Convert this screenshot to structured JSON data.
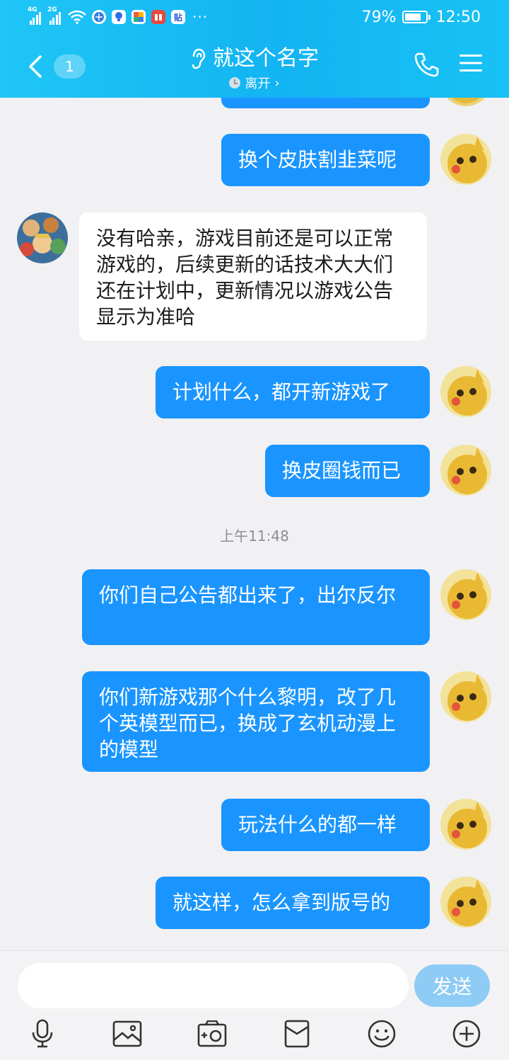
{
  "status_bar": {
    "signal_1_label": "4G",
    "signal_2_label": "2G",
    "battery_percent_text": "79%",
    "battery_level": 0.79,
    "time": "12:50",
    "app_icons": [
      "wifi-icon",
      "browser-icon",
      "lightbulb-icon",
      "colorful-app-icon",
      "book-icon",
      "tieba-icon"
    ]
  },
  "header": {
    "back_badge_count": "1",
    "title": "就这个名字",
    "title_icon": "ear-icon",
    "subtitle": "离开",
    "subtitle_arrow": "›",
    "phone_icon": "phone-icon",
    "menu_icon": "menu-icon"
  },
  "messages": [
    {
      "side": "me",
      "text": ""
    },
    {
      "side": "me",
      "text": "换个皮肤割韭菜呢"
    },
    {
      "side": "them",
      "text": "没有哈亲，游戏目前还是可以正常游戏的，后续更新的话技术大大们还在计划中，更新情况以游戏公告显示为准哈"
    },
    {
      "side": "me",
      "text": "计划什么，都开新游戏了"
    },
    {
      "side": "me",
      "text": "换皮圈钱而已"
    },
    {
      "timestamp": "上午11:48"
    },
    {
      "side": "me",
      "text": "你们自己公告都出来了，出尔反尔"
    },
    {
      "side": "me",
      "text": "你们新游戏那个什么黎明，改了几个英模型而已，换成了玄机动漫上的模型"
    },
    {
      "side": "me",
      "text": "玩法什么的都一样"
    },
    {
      "side": "me",
      "text": "就这样，怎么拿到版号的"
    }
  ],
  "input_bar": {
    "value": "",
    "send_label": "发送"
  },
  "toolbar": [
    "microphone-icon",
    "image-icon",
    "camera-icon",
    "red-packet-icon",
    "emoji-icon",
    "plus-icon"
  ],
  "colors": {
    "header": "#18bdf4",
    "my_bubble": "#1a95ff",
    "their_bubble": "#ffffff",
    "background": "#f1f1f3",
    "send_button": "#8ecbf5"
  }
}
